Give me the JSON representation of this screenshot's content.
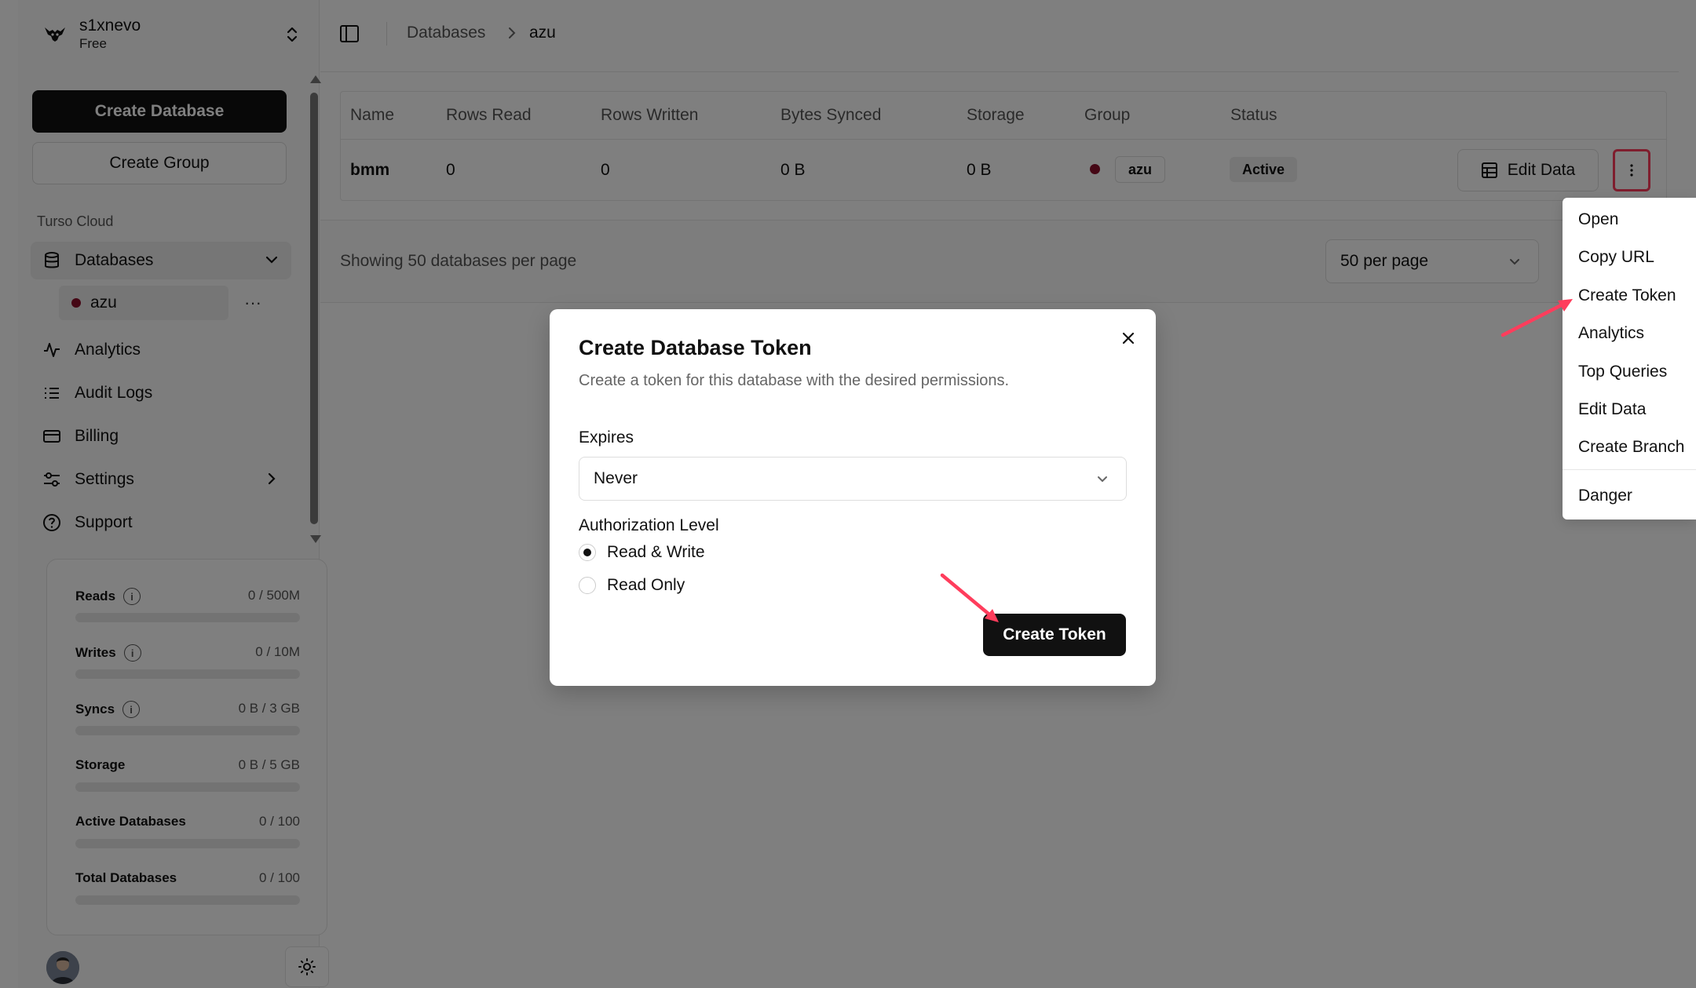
{
  "org": {
    "name": "s1xnevo",
    "plan": "Free"
  },
  "sidebar": {
    "create_database": "Create Database",
    "create_group": "Create Group",
    "section_label": "Turso Cloud",
    "nav": {
      "databases": "Databases",
      "database_item": "azu",
      "analytics": "Analytics",
      "audit_logs": "Audit Logs",
      "billing": "Billing",
      "settings": "Settings",
      "support": "Support"
    },
    "usage": [
      {
        "label": "Reads",
        "value": "0 / 500M",
        "info": true,
        "fraction": 0
      },
      {
        "label": "Writes",
        "value": "0 / 10M",
        "info": true,
        "fraction": 0
      },
      {
        "label": "Syncs",
        "value": "0 B / 3 GB",
        "info": true,
        "fraction": 0
      },
      {
        "label": "Storage",
        "value": "0 B / 5 GB",
        "info": false,
        "fraction": 0
      },
      {
        "label": "Active Databases",
        "value": "0 / 100",
        "info": false,
        "fraction": 0
      },
      {
        "label": "Total Databases",
        "value": "0 / 100",
        "info": false,
        "fraction": 0
      }
    ]
  },
  "breadcrumb": {
    "parent": "Databases",
    "current": "azu"
  },
  "table": {
    "headers": [
      "Name",
      "Rows Read",
      "Rows Written",
      "Bytes Synced",
      "Storage",
      "Group",
      "Status"
    ],
    "row": {
      "name": "bmm",
      "rows_read": "0",
      "rows_written": "0",
      "bytes_synced": "0 B",
      "storage": "0 B",
      "group": "azu",
      "status": "Active"
    },
    "edit_data": "Edit Data"
  },
  "pager": {
    "text": "Showing 50 databases per page",
    "per_page": "50 per page"
  },
  "menu": {
    "items": [
      "Open",
      "Copy URL",
      "Create Token",
      "Analytics",
      "Top Queries",
      "Edit Data",
      "Create Branch"
    ],
    "danger": "Danger"
  },
  "dialog": {
    "title": "Create Database Token",
    "description": "Create a token for this database with the desired permissions.",
    "expires_label": "Expires",
    "expires_value": "Never",
    "auth_label": "Authorization Level",
    "option_rw": "Read & Write",
    "option_ro": "Read Only",
    "submit": "Create Token"
  },
  "colors": {
    "accent_dark": "#111111",
    "group_dot": "#8b0e2a",
    "annotation": "#ff3d5c"
  }
}
